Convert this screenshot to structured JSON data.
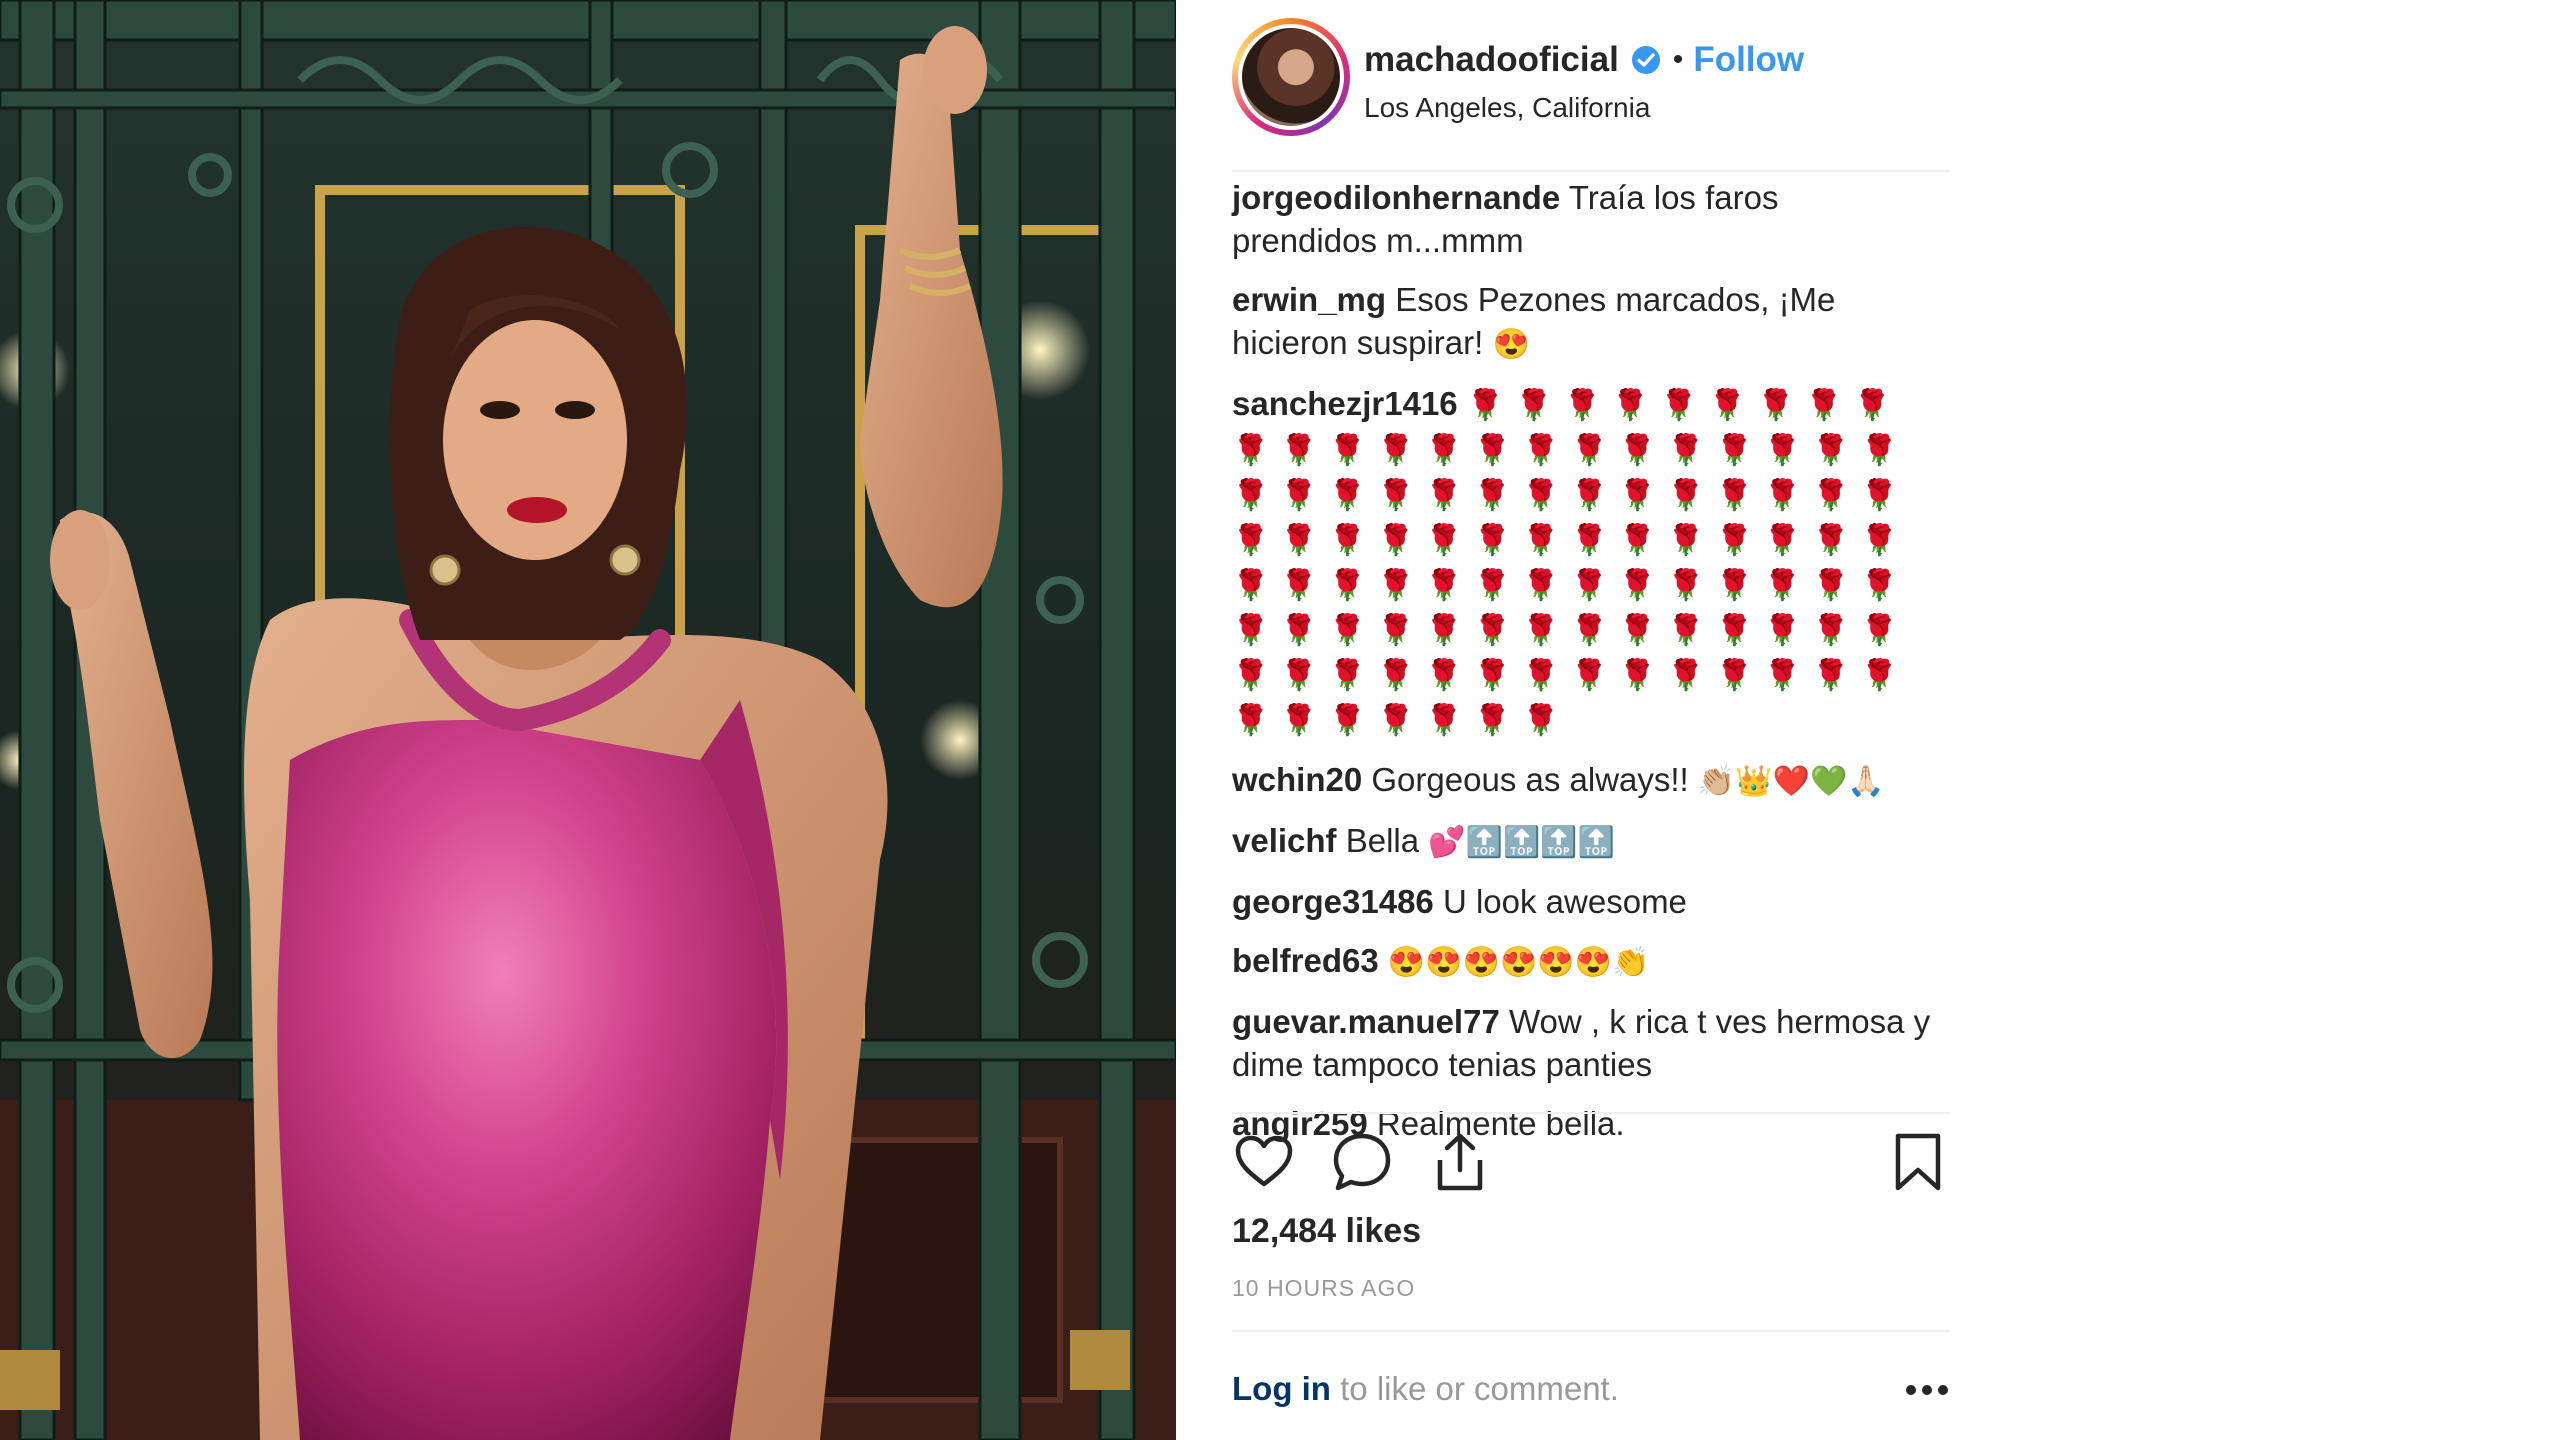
{
  "post": {
    "photo_alt": "woman-in-pink-satin-dress-at-ornate-gate"
  },
  "header": {
    "username": "machadooficial",
    "verified_icon": "verified-badge-icon",
    "separator": "•",
    "follow_label": "Follow",
    "location": "Los Angeles, California"
  },
  "comments": [
    {
      "user": "jorgeodilonhernande",
      "text": "Traía los faros prendidos m...mmm"
    },
    {
      "user": "erwin_mg",
      "text": "Esos Pezones marcados, ¡Me hicieron suspirar!",
      "emoji": "😍"
    },
    {
      "user": "sanchezjr1416",
      "roses": "🌹🌹🌹🌹🌹🌹🌹🌹🌹🌹🌹🌹🌹🌹🌹🌹🌹🌹🌹🌹🌹🌹🌹🌹🌹🌹🌹🌹🌹🌹🌹🌹🌹🌹🌹🌹🌹🌹🌹🌹🌹🌹🌹🌹🌹🌹🌹🌹🌹🌹🌹🌹🌹🌹🌹🌹🌹🌹🌹🌹🌹🌹🌹🌹🌹🌹🌹🌹🌹🌹🌹🌹🌹🌹🌹🌹🌹🌹🌹🌹🌹🌹🌹🌹🌹🌹🌹🌹🌹🌹🌹🌹🌹🌹🌹🌹🌹🌹🌹🌹"
    },
    {
      "user": "wchin20",
      "text": "Gorgeous as always!!",
      "emoji": "👏🏼👑❤️💚🙏🏻"
    },
    {
      "user": "velichf",
      "text": "Bella",
      "emoji": "💕🔝🔝🔝🔝"
    },
    {
      "user": "george31486",
      "text": "U look awesome"
    },
    {
      "user": "belfred63",
      "emoji": "😍😍😍😍😍😍👏"
    },
    {
      "user": "guevar.manuel77",
      "text": "Wow , k rica t ves hermosa y dime tampoco tenias panties"
    },
    {
      "user": "angir259",
      "text": "Realmente bella."
    }
  ],
  "actions": {
    "like_icon": "heart-icon",
    "comment_icon": "comment-bubble-icon",
    "share_icon": "share-icon",
    "save_icon": "bookmark-icon"
  },
  "likes": "12,484 likes",
  "timestamp": "10 HOURS AGO",
  "login": {
    "link_label": "Log in",
    "suffix": " to like or comment."
  },
  "more_icon": "more-options-icon",
  "colors": {
    "link_blue": "#3897f0",
    "login_blue": "#003569",
    "text": "#262626",
    "muted": "#999999",
    "dress_pink": "#c2307a"
  }
}
